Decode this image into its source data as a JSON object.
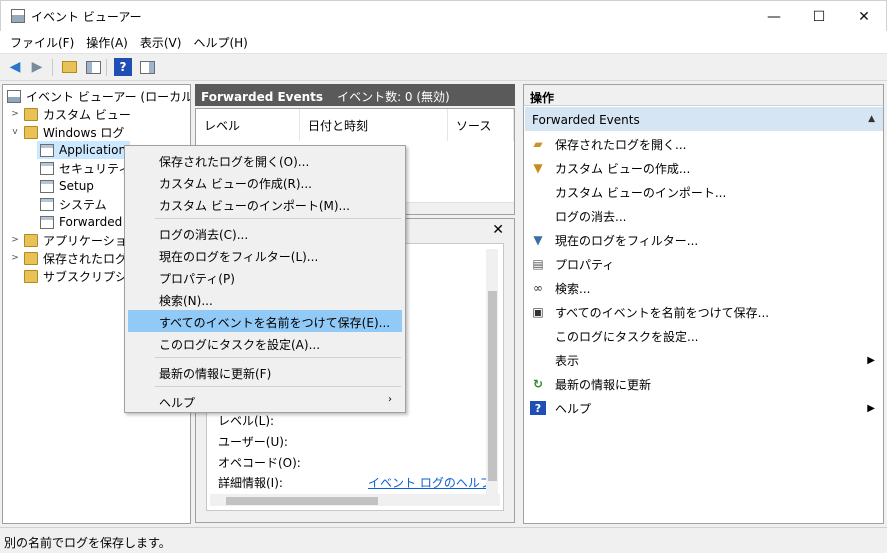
{
  "window": {
    "title": "イベント ビューアー",
    "min": "—",
    "max": "☐",
    "close": "✕"
  },
  "menu": [
    "ファイル(F)",
    "操作(A)",
    "表示(V)",
    "ヘルプ(H)"
  ],
  "tree": {
    "items": [
      {
        "label": "イベント ビューアー (ローカル)",
        "icon": "event-viewer-icon"
      },
      {
        "label": "カスタム ビュー",
        "icon": "folder-icon",
        "twisty": ">"
      },
      {
        "label": "Windows ログ",
        "icon": "folder-icon",
        "twisty": "v"
      },
      {
        "label": "Application",
        "icon": "log-icon"
      },
      {
        "label": "セキュリティ",
        "icon": "log-icon"
      },
      {
        "label": "Setup",
        "icon": "log-icon"
      },
      {
        "label": "システム",
        "icon": "log-icon"
      },
      {
        "label": "Forwarded",
        "icon": "log-icon"
      },
      {
        "label": "アプリケーションと",
        "icon": "folder-icon",
        "twisty": ">"
      },
      {
        "label": "保存されたログ",
        "icon": "folder-icon",
        "twisty": ">"
      },
      {
        "label": "サブスクリプション",
        "icon": "folder-icon"
      }
    ]
  },
  "list": {
    "title": "Forwarded Events",
    "count": "イベント数: 0 (無効)",
    "columns": [
      "レベル",
      "日付と時刻",
      "ソース"
    ]
  },
  "detail": {
    "close": "✕",
    "labels": [
      "レベル(L):",
      "ユーザー(U):",
      "オペコード(O):",
      "詳細情報(I):"
    ],
    "link": "イベント ログのヘルプ"
  },
  "actions": {
    "header": "操作",
    "sub": "Forwarded Events",
    "items": [
      "保存されたログを開く...",
      "カスタム ビューの作成...",
      "カスタム ビューのインポート...",
      "ログの消去...",
      "現在のログをフィルター...",
      "プロパティ",
      "検索...",
      "すべてのイベントを名前をつけて保存...",
      "このログにタスクを設定...",
      "表示",
      "最新の情報に更新",
      "ヘルプ"
    ]
  },
  "context_menu": {
    "items": [
      "保存されたログを開く(O)...",
      "カスタム ビューの作成(R)...",
      "カスタム ビューのインポート(M)...",
      "ログの消去(C)...",
      "現在のログをフィルター(L)...",
      "プロパティ(P)",
      "検索(N)...",
      "すべてのイベントを名前をつけて保存(E)...",
      "このログにタスクを設定(A)...",
      "最新の情報に更新(F)",
      "ヘルプ"
    ],
    "highlighted_index": 7
  },
  "status": "別の名前でログを保存します。",
  "colors": {
    "accent": "#cce8ff",
    "highlight": "#91c9f7",
    "pane_header": "#5a5a5a",
    "link": "#0b5ed7"
  }
}
